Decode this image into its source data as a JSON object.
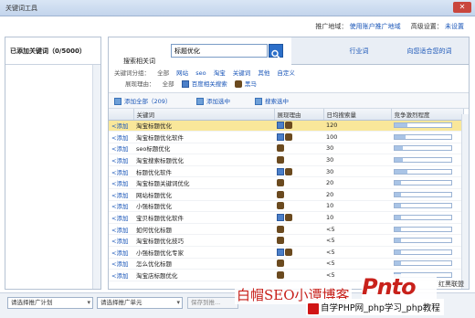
{
  "window": {
    "title": "关键词工具",
    "close": "✕"
  },
  "top": {
    "region_label": "推广地域：",
    "region_value": "使用账户推广地域",
    "adv_label": "高级设置：",
    "adv_value": "未设置"
  },
  "left": {
    "header": "已添加关键词（0/5000）"
  },
  "tabs": {
    "search_label": "搜索相关词",
    "search_value": "标题优化",
    "industry": "行业词",
    "suggest": "向您适合您的词"
  },
  "filters": {
    "group_label": "关键词分组：",
    "groups": [
      "全部",
      "网站",
      "seo",
      "淘宝",
      "关键词",
      "其他",
      "自定义"
    ],
    "reason_label": "展现理由：",
    "reasons": [
      "全部",
      "百度相关搜索",
      "黑马"
    ]
  },
  "toolbar": {
    "add_all": "添加全部（209）",
    "add_selected": "添加选中",
    "search_selected": "搜索选中"
  },
  "table": {
    "headers": [
      "关键词",
      "展现理由",
      "日均搜索量",
      "竞争激烈程度"
    ],
    "add_label": "<添加",
    "rows": [
      {
        "kw": "淘宝标题优化",
        "reasons": [
          "baidu",
          "horse"
        ],
        "vol": "120",
        "comp": 0.22,
        "sel": true
      },
      {
        "kw": "淘宝标题优化软件",
        "reasons": [
          "baidu",
          "horse"
        ],
        "vol": "100",
        "comp": 0.2
      },
      {
        "kw": "seo标题优化",
        "reasons": [
          "horse"
        ],
        "vol": "30",
        "comp": 0.15
      },
      {
        "kw": "淘宝搜索标题优化",
        "reasons": [
          "horse"
        ],
        "vol": "30",
        "comp": 0.15
      },
      {
        "kw": "标题优化软件",
        "reasons": [
          "baidu",
          "horse"
        ],
        "vol": "30",
        "comp": 0.22
      },
      {
        "kw": "淘宝标题关键词优化",
        "reasons": [
          "horse"
        ],
        "vol": "20",
        "comp": 0.12
      },
      {
        "kw": "网站标题优化",
        "reasons": [
          "horse"
        ],
        "vol": "20",
        "comp": 0.12
      },
      {
        "kw": "小强标题优化",
        "reasons": [
          "horse"
        ],
        "vol": "10",
        "comp": 0.12
      },
      {
        "kw": "宝贝标题优化软件",
        "reasons": [
          "baidu",
          "horse"
        ],
        "vol": "10",
        "comp": 0.12
      },
      {
        "kw": "如何优化标题",
        "reasons": [
          "horse"
        ],
        "vol": "<5",
        "comp": 0.12
      },
      {
        "kw": "淘宝标题优化技巧",
        "reasons": [
          "horse"
        ],
        "vol": "<5",
        "comp": 0.12
      },
      {
        "kw": "小强标题优化专家",
        "reasons": [
          "baidu",
          "horse"
        ],
        "vol": "<5",
        "comp": 0.12
      },
      {
        "kw": "怎么优化标题",
        "reasons": [
          "horse"
        ],
        "vol": "<5",
        "comp": 0.12
      },
      {
        "kw": "淘宝店标题优化",
        "reasons": [
          "horse"
        ],
        "vol": "<5",
        "comp": 0.12
      }
    ]
  },
  "bottom": {
    "plan": "请选择推广计划",
    "unit": "请选择推广单元",
    "save": "保存到推..."
  },
  "watermark": {
    "blog": "白帽SEO小谭博客",
    "logo": "Pnto",
    "logo_side": "红黑联盟",
    "site": "自学PHP网_php学习_php教程"
  }
}
